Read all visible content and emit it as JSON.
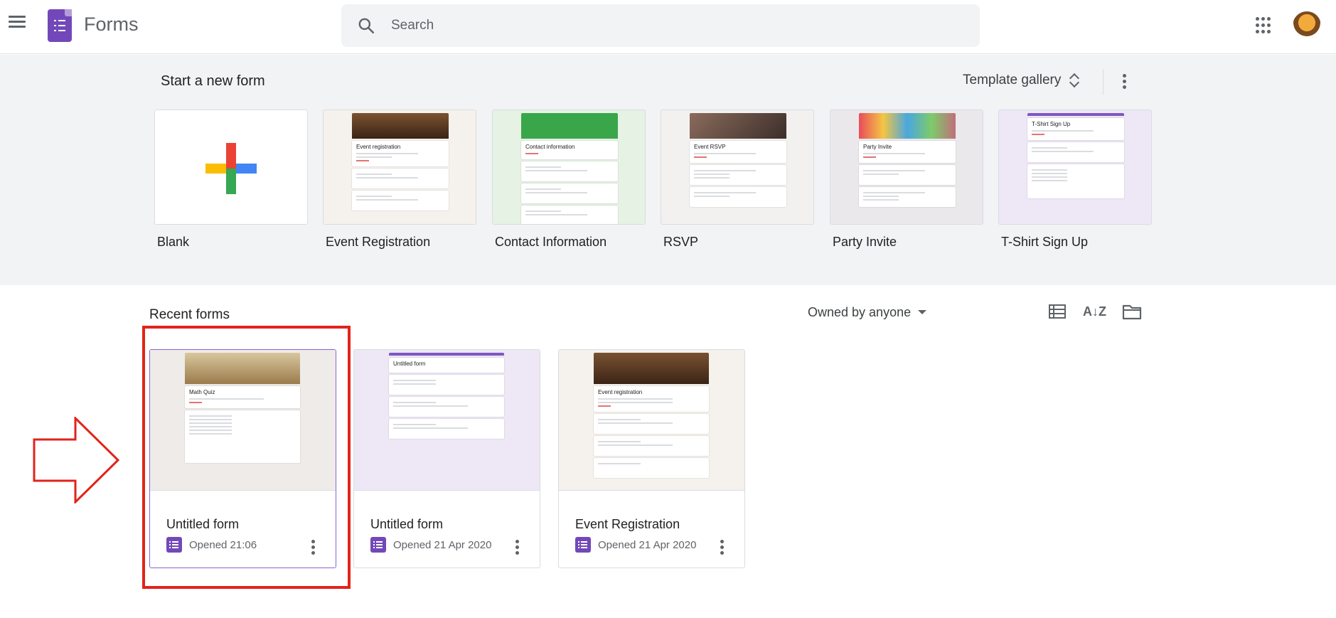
{
  "header": {
    "app_title": "Forms",
    "search_placeholder": "Search"
  },
  "templates": {
    "section_title": "Start a new form",
    "gallery_label": "Template gallery",
    "items": [
      {
        "label": "Blank"
      },
      {
        "label": "Event Registration",
        "preview_title": "Event registration",
        "banner_color": "#5b3a23"
      },
      {
        "label": "Contact Information",
        "preview_title": "Contact information",
        "banner_color": "#3aa64a"
      },
      {
        "label": "RSVP",
        "preview_title": "Event RSVP",
        "banner_color": "#6b4e44"
      },
      {
        "label": "Party Invite",
        "preview_title": "Party Invite",
        "banner_color": "#c06f7a"
      },
      {
        "label": "T-Shirt Sign Up",
        "preview_title": "T-Shirt Sign Up",
        "banner_color": "#7e57c2"
      }
    ]
  },
  "recent": {
    "section_title": "Recent forms",
    "owner_filter": "Owned by anyone",
    "forms": [
      {
        "name": "Untitled form",
        "opened": "Opened 21:06",
        "preview_title": "Math Quiz",
        "banner_color": "#b59b6a",
        "selected": true
      },
      {
        "name": "Untitled form",
        "opened": "Opened 21 Apr 2020",
        "preview_title": "Untitled form",
        "banner_color": "#7e57c2",
        "selected": false
      },
      {
        "name": "Event Registration",
        "opened": "Opened 21 Apr 2020",
        "preview_title": "Event registration",
        "banner_color": "#5b3a23",
        "selected": false
      }
    ]
  },
  "colors": {
    "brand": "#7248b9",
    "highlight": "#e2231a"
  }
}
